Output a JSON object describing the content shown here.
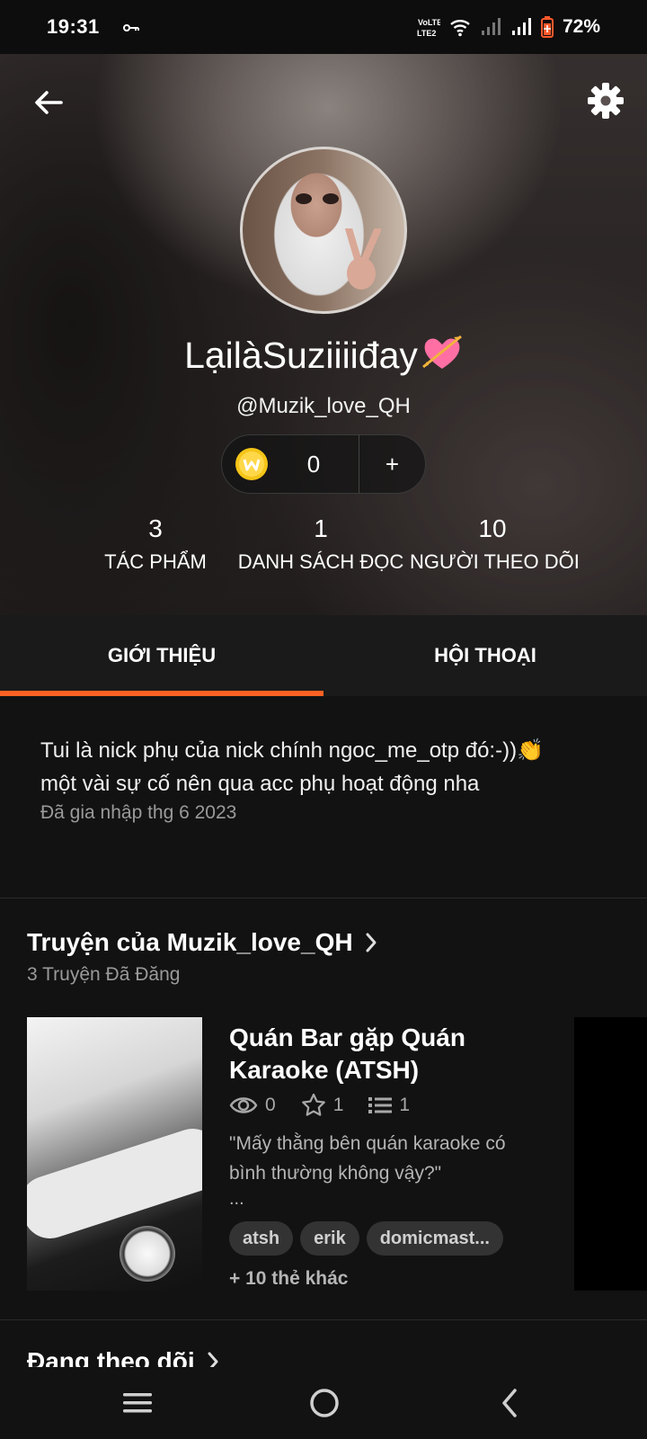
{
  "status_bar": {
    "time": "19:31",
    "battery": "72%",
    "lte_label": "LTE2",
    "volte_label": "VoLTE"
  },
  "profile": {
    "display_name": "LạilàSuziiiiđay",
    "username": "@Muzik_love_QH",
    "coins": "0",
    "coin_add": "+",
    "stats": [
      {
        "value": "3",
        "label": "TÁC PHẨM"
      },
      {
        "value": "1",
        "label": "DANH SÁCH ĐỌC"
      },
      {
        "value": "10",
        "label": "NGƯỜI THEO DÕI"
      }
    ]
  },
  "tabs": [
    {
      "label": "GIỚI THIỆU",
      "active": true
    },
    {
      "label": "HỘI THOẠI",
      "active": false
    }
  ],
  "about": {
    "bio_line1": "Tui là nick phụ của nick chính ngoc_me_otp đó:-))👏",
    "bio_line2": "một vài sự cố nên qua acc phụ hoạt động nha",
    "joined": "Đã gia nhập thg 6 2023"
  },
  "stories": {
    "title": "Truyện của Muzik_love_QH",
    "subtitle": "3 Truyện Đã Đăng",
    "items": [
      {
        "title": "Quán Bar gặp Quán Karaoke (ATSH)",
        "reads": "0",
        "votes": "1",
        "parts": "1",
        "description": "\"Mấy thằng bên quán karaoke có bình thường không vậy?\"",
        "ellipsis": "...",
        "tags": [
          "atsh",
          "erik",
          "domicmast..."
        ],
        "more_tags": "+ 10 thẻ khác"
      }
    ]
  },
  "following": {
    "title": "Đang theo dõi"
  },
  "colors": {
    "accent": "#ff6122",
    "background": "#121212",
    "tab_bg": "#1a1a1a",
    "coin": "#f5c518"
  }
}
